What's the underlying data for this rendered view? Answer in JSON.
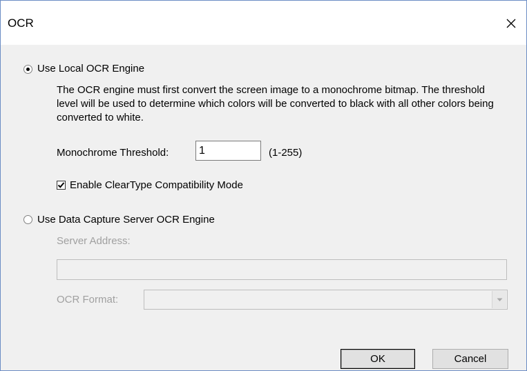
{
  "window": {
    "title": "OCR",
    "close_glyph": "✕"
  },
  "local_engine": {
    "label": "Use Local OCR Engine",
    "selected": true,
    "description": "The OCR engine must first convert the screen image to a monochrome bitmap.  The threshold level will be used to determine which colors will be converted to black with all other colors being converted to white.",
    "threshold_label": "Monochrome Threshold:",
    "threshold_value": "1",
    "threshold_range": "(1-255)",
    "cleartype_label": "Enable ClearType Compatibility Mode",
    "cleartype_checked": true
  },
  "server_engine": {
    "label": "Use Data Capture Server OCR Engine",
    "selected": false,
    "server_address_label": "Server Address:",
    "server_address_value": "",
    "ocr_format_label": "OCR Format:",
    "ocr_format_value": ""
  },
  "buttons": {
    "ok": "OK",
    "cancel": "Cancel"
  },
  "icons": {
    "close": "close-icon",
    "check": "check-icon",
    "dropdown": "chevron-down-icon"
  }
}
